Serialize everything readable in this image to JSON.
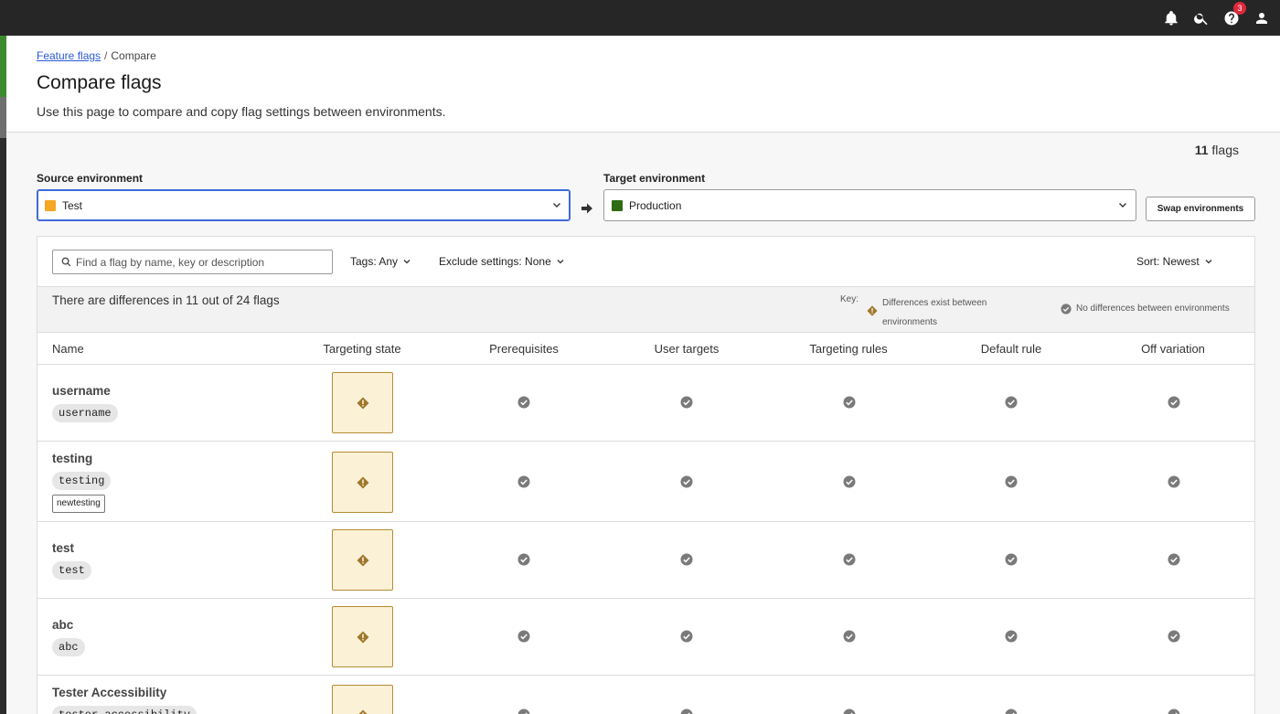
{
  "topbar": {
    "icons": [
      "bell-icon",
      "search-icon",
      "help-icon",
      "user-icon"
    ],
    "help_badge": "3"
  },
  "breadcrumb": {
    "link": "Feature flags",
    "separator": "/",
    "current": "Compare"
  },
  "page": {
    "title": "Compare flags",
    "description": "Use this page to compare and copy flag settings between environments."
  },
  "flag_count": {
    "number": "11",
    "unit": "flags"
  },
  "source": {
    "label": "Source environment",
    "value": "Test",
    "color": "#f5a623"
  },
  "target": {
    "label": "Target environment",
    "value": "Production",
    "color": "#2e6b12"
  },
  "swap_label": "Swap environments",
  "toolbar": {
    "search_placeholder": "Find a flag by name, key or description",
    "tags": "Tags: Any",
    "exclude": "Exclude settings: None",
    "sort": "Sort: Newest"
  },
  "summary": {
    "text": "There are differences in 11 out of 24 flags",
    "key_label": "Key:",
    "diff_text": "Differences exist between environments",
    "nodiff_text": "No differences between environments"
  },
  "columns": [
    "Name",
    "Targeting state",
    "Prerequisites",
    "User targets",
    "Targeting rules",
    "Default rule",
    "Off variation"
  ],
  "rows": [
    {
      "name": "username",
      "key": "username",
      "tag": ""
    },
    {
      "name": "testing",
      "key": "testing",
      "tag": "newtesting"
    },
    {
      "name": "test",
      "key": "test",
      "tag": ""
    },
    {
      "name": "abc",
      "key": "abc",
      "tag": ""
    },
    {
      "name": "Tester Accessibility",
      "key": "tester-accessibility",
      "tag": ""
    }
  ],
  "colors": {
    "accent": "#3d6bd9",
    "diff_bg": "#fbf1d6",
    "diff_border": "#b38c34",
    "check": "#7a7a7a"
  }
}
